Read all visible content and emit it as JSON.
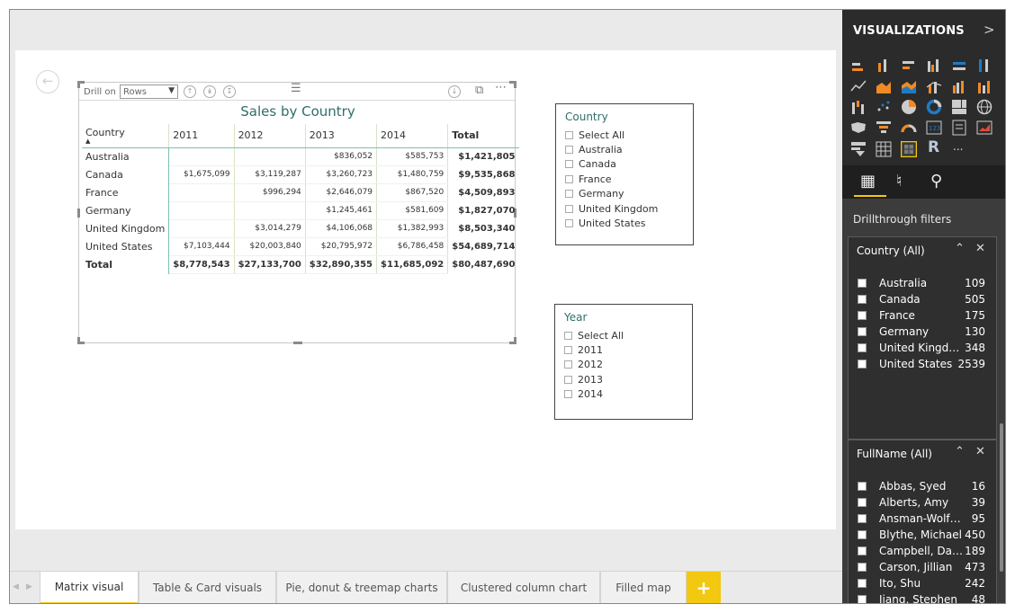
{
  "visual": {
    "drill_on_label": "Drill on",
    "drill_level": "Rows",
    "title": "Sales by Country",
    "columns": [
      "Country",
      "2011",
      "2012",
      "2013",
      "2014",
      "Total"
    ],
    "rows": [
      {
        "label": "Australia",
        "cells": [
          "",
          "",
          "$836,052",
          "$585,753",
          "$1,421,805"
        ]
      },
      {
        "label": "Canada",
        "cells": [
          "$1,675,099",
          "$3,119,287",
          "$3,260,723",
          "$1,480,759",
          "$9,535,868"
        ]
      },
      {
        "label": "France",
        "cells": [
          "",
          "$996,294",
          "$2,646,079",
          "$867,520",
          "$4,509,893"
        ]
      },
      {
        "label": "Germany",
        "cells": [
          "",
          "",
          "$1,245,461",
          "$581,609",
          "$1,827,070"
        ]
      },
      {
        "label": "United Kingdom",
        "cells": [
          "",
          "$3,014,279",
          "$4,106,068",
          "$1,382,993",
          "$8,503,340"
        ]
      },
      {
        "label": "United States",
        "cells": [
          "$7,103,444",
          "$20,003,840",
          "$20,795,972",
          "$6,786,458",
          "$54,689,714"
        ]
      }
    ],
    "total_row": {
      "label": "Total",
      "cells": [
        "$8,778,543",
        "$27,133,700",
        "$32,890,355",
        "$11,685,092",
        "$80,487,690"
      ]
    }
  },
  "country_slicer": {
    "title": "Country",
    "items": [
      "Select All",
      "Australia",
      "Canada",
      "France",
      "Germany",
      "United Kingdom",
      "United States"
    ]
  },
  "year_slicer": {
    "title": "Year",
    "items": [
      "Select All",
      "2011",
      "2012",
      "2013",
      "2014"
    ]
  },
  "tabs": [
    {
      "label": "Matrix visual",
      "active": true
    },
    {
      "label": "Table & Card visuals",
      "active": false
    },
    {
      "label": "Pie, donut & treemap charts",
      "active": false
    },
    {
      "label": "Clustered column chart",
      "active": false
    },
    {
      "label": "Filled map",
      "active": false
    }
  ],
  "add_tab_label": "+",
  "viz_pane": {
    "title": "VISUALIZATIONS",
    "collapse_glyph": ">",
    "r_visual_label": "R",
    "more_visuals_label": "...",
    "drillthrough_label": "Drillthrough filters",
    "country_filter": {
      "header": "Country (All)",
      "items": [
        {
          "name": "Australia",
          "count": "109"
        },
        {
          "name": "Canada",
          "count": "505"
        },
        {
          "name": "France",
          "count": "175"
        },
        {
          "name": "Germany",
          "count": "130"
        },
        {
          "name": "United Kingdom",
          "count": "348"
        },
        {
          "name": "United States",
          "count": "2539"
        }
      ]
    },
    "fullname_filter": {
      "header": "FullName (All)",
      "items": [
        {
          "name": "Abbas, Syed",
          "count": "16"
        },
        {
          "name": "Alberts, Amy",
          "count": "39"
        },
        {
          "name": "Ansman-Wolfe, ...",
          "count": "95"
        },
        {
          "name": "Blythe, Michael",
          "count": "450"
        },
        {
          "name": "Campbell, David",
          "count": "189"
        },
        {
          "name": "Carson, Jillian",
          "count": "473"
        },
        {
          "name": "Ito, Shu",
          "count": "242"
        },
        {
          "name": "Jiang, Stephen",
          "count": "48"
        }
      ]
    }
  },
  "colors": {
    "accent": "#f2c811",
    "title_teal": "#2f6e6a",
    "pane_dark": "#2b2b2b"
  }
}
